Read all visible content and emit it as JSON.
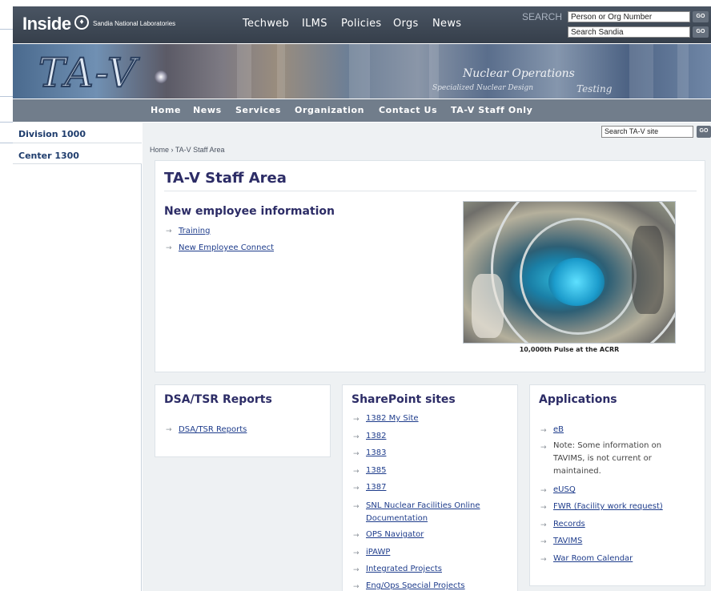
{
  "topbar": {
    "inside": "Inside",
    "org": "Sandia National Laboratories",
    "nav": [
      "Techweb",
      "ILMS",
      "Policies",
      "Orgs",
      "News"
    ],
    "search_label": "SEARCH",
    "search1_value": "Person or Org Number",
    "search2_value": "Search Sandia",
    "go": "GO"
  },
  "banner": {
    "logo_text": "TA-V",
    "tagline": "Nuclear Operations",
    "tagline2": "Specialized Nuclear Design",
    "tagline3": "Testing"
  },
  "nav": [
    "Home",
    "News",
    "Services",
    "Organization",
    "Contact Us",
    "TA-V Staff Only"
  ],
  "left": {
    "items": [
      "Division 1000",
      "Center 1300"
    ]
  },
  "search_tav": {
    "value": "Search TA-V site",
    "go": "GO"
  },
  "breadcrumb": "Home › TA-V Staff Area",
  "main": {
    "title": "TA-V Staff Area",
    "section_title": "New employee information",
    "links": [
      "Training",
      "New Employee Connect"
    ],
    "photo_caption": "10,000th Pulse at the ACRR"
  },
  "dsa": {
    "title": "DSA/TSR Reports",
    "links": [
      "DSA/TSR Reports"
    ]
  },
  "sharepoint": {
    "title": "SharePoint sites",
    "links": [
      "1382 My Site",
      "1382",
      "1383",
      "1385",
      "1387",
      "SNL Nuclear Facilities Online",
      "Documentation",
      "OPS Navigator",
      "iPAWP",
      "Integrated Projects",
      "Eng/Ops Special Projects"
    ]
  },
  "apps": {
    "title": "Applications",
    "links": [
      "eB",
      "eUSQ",
      "FWR (Facility work request)",
      "Records",
      "TAVIMS",
      "War Room Calendar"
    ],
    "note": [
      "Note: Some information on",
      "TAVIMS, is not current or",
      "maintained."
    ]
  },
  "colors": {
    "header": "#3d4653",
    "nav": "#717d8b",
    "link": "#1f3d8c",
    "heading": "#2c2c66"
  }
}
